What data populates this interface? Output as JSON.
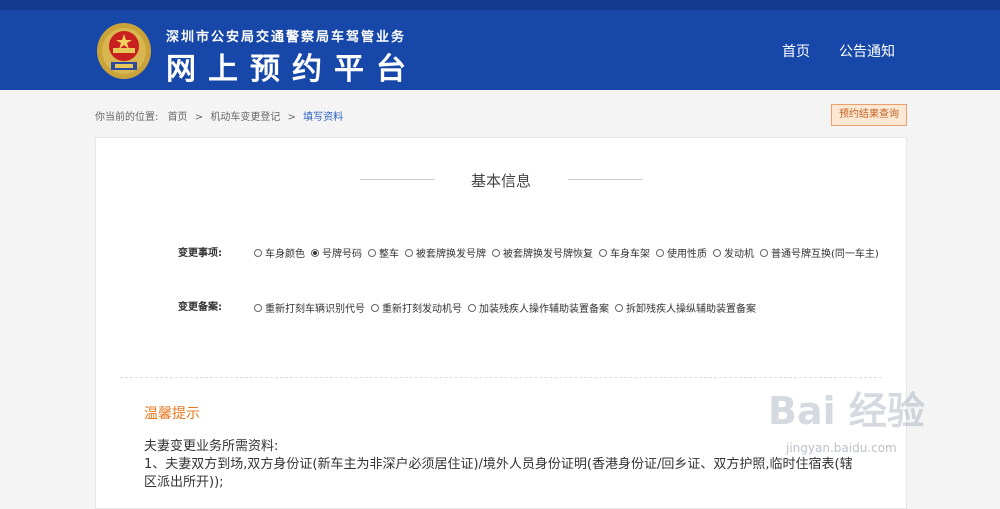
{
  "header": {
    "subtitle": "深圳市公安局交通警察局车驾管业务",
    "title": "网上预约平台",
    "nav": [
      "首页",
      "公告通知"
    ]
  },
  "breadcrumb": {
    "prefix": "你当前的位置:",
    "items": [
      "首页",
      "机动车变更登记",
      "填写资料"
    ]
  },
  "query_button": "预约结果查询",
  "section_title": "基本信息",
  "change_items": {
    "label": "变更事项:",
    "options": [
      "车身颜色",
      "号牌号码",
      "整车",
      "被套牌换发号牌",
      "被套牌换发号牌恢复",
      "车身车架",
      "使用性质",
      "发动机",
      "普通号牌互换(同一车主)"
    ],
    "selected_index": 1
  },
  "change_records": {
    "label": "变更备案:",
    "options": [
      "重新打刻车辆识别代号",
      "重新打刻发动机号",
      "加装残疾人操作辅助装置备案",
      "拆卸残疾人操纵辅助装置备案"
    ]
  },
  "tips": {
    "title": "温馨提示",
    "lines": [
      "夫妻变更业务所需资料:",
      "1、夫妻双方到场,双方身份证(新车主为非深户必须居住证)/境外人员身份证明(香港身份证/回乡证、双方护照,临时住宿表(辖区派出所开));"
    ]
  },
  "watermark": {
    "brand": "Bai 经验",
    "url": "jingyan.baidu.com"
  },
  "colors": {
    "header_bg": "#1747a8",
    "accent_orange": "#e8791f",
    "link_blue": "#2a5fc2"
  }
}
